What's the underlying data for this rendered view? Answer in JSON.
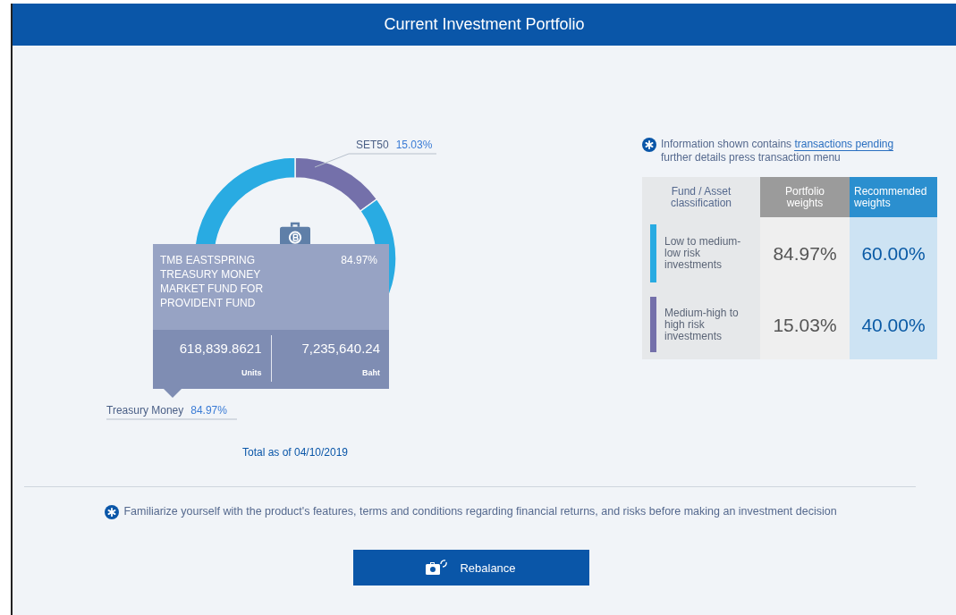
{
  "header": {
    "title": "Current Investment Portfolio"
  },
  "portfolio": {
    "chart_data": {
      "type": "donut",
      "categories": [
        "Treasury Money",
        "SET50"
      ],
      "values": [
        84.97,
        15.03
      ],
      "value_labels": [
        "84.97%",
        "15.03%"
      ]
    },
    "tooltip": {
      "fund": "TMB EASTSPRING TREASURY MONEY MARKET FUND FOR PROVIDENT FUND",
      "share": "84.97%",
      "units": "618,839.8621",
      "units_label": "Units",
      "value": "7,235,640.24",
      "value_label": "Baht"
    },
    "as_of": "Total as of 04/10/2019"
  },
  "info_note": {
    "before": "Information shown contains ",
    "link": "transactions pending",
    "after": " further details press transaction menu"
  },
  "allocation_table": {
    "columns": [
      "Fund / Asset classification",
      "Portfolio weights",
      "Recommended weights"
    ],
    "rows": [
      {
        "label": "Low to medium-low risk investments",
        "color": "#29abe2",
        "portfolio": "84.97%",
        "recommended": "60.00%"
      },
      {
        "label": "Medium-high to high risk investments",
        "color": "#7470aa",
        "portfolio": "15.03%",
        "recommended": "40.00%"
      }
    ]
  },
  "disclaimer": "Familiarize yourself with the product's features, terms and conditions regarding financial returns, and risks before making an investment decision",
  "buttons": [
    {
      "label": "Rebalance"
    }
  ]
}
